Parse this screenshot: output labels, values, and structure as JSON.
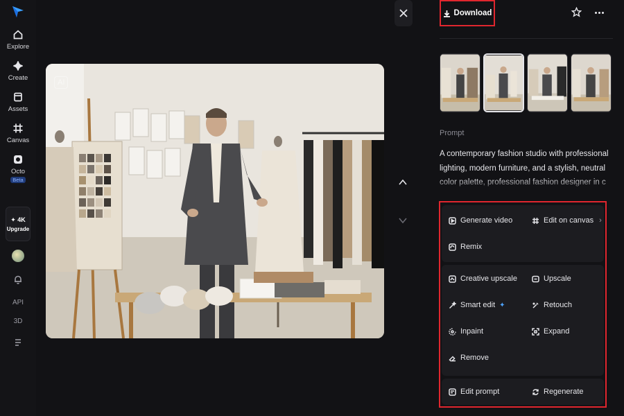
{
  "sidebar": {
    "items": [
      {
        "label": "Explore",
        "icon": "home-icon"
      },
      {
        "label": "Create",
        "icon": "sparkle-icon"
      },
      {
        "label": "Assets",
        "icon": "folder-icon"
      },
      {
        "label": "Canvas",
        "icon": "grid-icon"
      },
      {
        "label": "Octo",
        "icon": "octo-icon",
        "badge": "Beta"
      }
    ],
    "upgrade": {
      "tier": "✦ 4K",
      "label": "Upgrade"
    },
    "api_label": "API",
    "threed_label": "3D"
  },
  "viewer": {
    "ai_mark": "AI"
  },
  "panel": {
    "download_label": "Download",
    "prompt_label": "Prompt",
    "prompt_text": "A contemporary fashion studio with professional lighting, modern furniture, and a stylish, neutral color palette, professional fashion designer in charcoal gray tailored bla",
    "actions": {
      "generate_video": "Generate video",
      "edit_on_canvas": "Edit on canvas",
      "remix": "Remix",
      "creative_upscale": "Creative upscale",
      "upscale": "Upscale",
      "smart_edit": "Smart edit",
      "retouch": "Retouch",
      "inpaint": "Inpaint",
      "expand": "Expand",
      "remove": "Remove",
      "edit_prompt": "Edit prompt",
      "regenerate": "Regenerate"
    }
  },
  "colors": {
    "accent_red": "#e0262e",
    "beta_blue": "#8fb4ff",
    "background": "#121215"
  }
}
